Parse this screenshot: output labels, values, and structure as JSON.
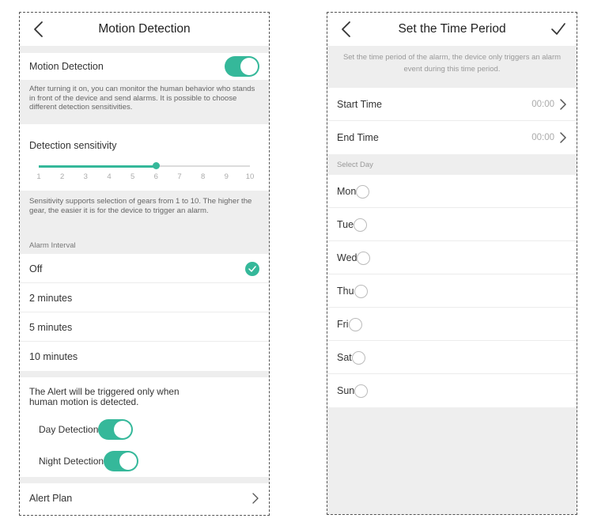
{
  "accent_color": "#35b89a",
  "motion_screen": {
    "title": "Motion Detection",
    "motion_toggle": {
      "label": "Motion Detection",
      "on": true
    },
    "motion_description": "After turning it on, you can monitor the human behavior who stands in front of the device and send alarms. It is possible to choose different detection sensitivities.",
    "sensitivity": {
      "label": "Detection sensitivity",
      "min": 1,
      "max": 10,
      "value": 6,
      "ticks": [
        "1",
        "2",
        "3",
        "4",
        "5",
        "6",
        "7",
        "8",
        "9",
        "10"
      ],
      "description": "Sensitivity supports selection of gears from 1 to 10. The higher the gear, the easier it is for the device to trigger an alarm."
    },
    "alarm_interval": {
      "label": "Alarm Interval",
      "options": [
        "Off",
        "2 minutes",
        "5 minutes",
        "10 minutes"
      ],
      "selected": "Off"
    },
    "alert_note": "The Alert will be triggered only when human motion is detected.",
    "day_detection": {
      "label": "Day Detection",
      "on": true
    },
    "night_detection": {
      "label": "Night Detection",
      "on": true
    },
    "alert_plan_label": "Alert Plan"
  },
  "time_screen": {
    "title": "Set the Time Period",
    "info": "Set the time period of the alarm, the device only triggers an alarm event during this time period.",
    "start_time": {
      "label": "Start Time",
      "value": "00:00"
    },
    "end_time": {
      "label": "End Time",
      "value": "00:00"
    },
    "select_day_label": "Select Day",
    "days": [
      {
        "label": "Mon",
        "selected": false
      },
      {
        "label": "Tue",
        "selected": false
      },
      {
        "label": "Wed",
        "selected": false
      },
      {
        "label": "Thu",
        "selected": false
      },
      {
        "label": "Fri",
        "selected": false
      },
      {
        "label": "Sat",
        "selected": false
      },
      {
        "label": "Sun",
        "selected": false
      }
    ]
  }
}
